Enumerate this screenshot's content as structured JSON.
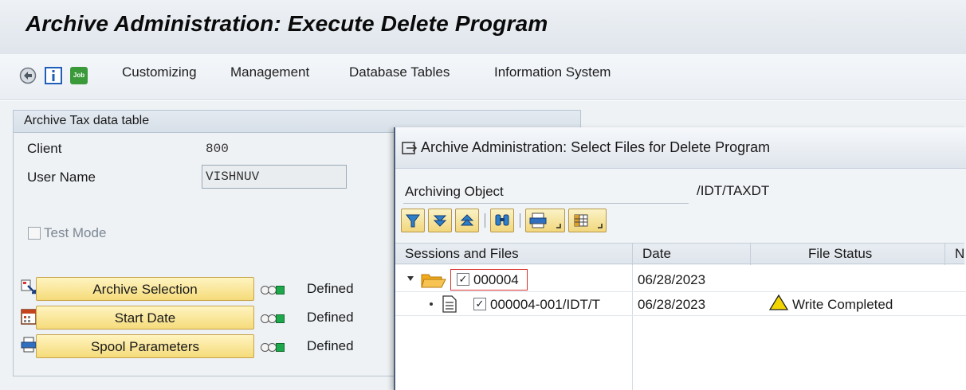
{
  "window": {
    "title": "Archive Administration: Execute Delete Program"
  },
  "menu": {
    "icons": [
      "execute-icon",
      "info-icon",
      "job-icon"
    ],
    "job_icon_text": "Job",
    "items": [
      "Customizing",
      "Management",
      "Database Tables",
      "Information System"
    ]
  },
  "group": {
    "title": "Archive Tax data table",
    "client_label": "Client",
    "client_value": "800",
    "user_label": "User Name",
    "user_value": "VISHNUV",
    "test_mode_label": "Test Mode",
    "test_mode_checked": false
  },
  "actions": [
    {
      "label": "Archive Selection",
      "icon": "selection-icon",
      "status": "Defined"
    },
    {
      "label": "Start Date",
      "icon": "calendar-icon",
      "status": "Defined"
    },
    {
      "label": "Spool Parameters",
      "icon": "printer-icon",
      "status": "Defined"
    }
  ],
  "dialog": {
    "title": "Archive Administration: Select Files for Delete Program",
    "archiving_object_label": "Archiving Object",
    "archiving_object_value": "/IDT/TAXDT",
    "columns": [
      "Sessions and Files",
      "Date",
      "File Status",
      "N"
    ],
    "rows": [
      {
        "name": "000004",
        "date": "06/28/2023",
        "status": "",
        "checked": true,
        "type": "folder"
      },
      {
        "name": "000004-001/IDT/T",
        "date": "06/28/2023",
        "status": "Write Completed",
        "checked": true,
        "type": "file"
      }
    ]
  },
  "colors": {
    "button_fill": "#f5db7a",
    "status_green": "#1ea84b",
    "dialog_border": "#4a5f7a",
    "focus_red": "#d8322f",
    "warning_yellow": "#f2d400"
  }
}
